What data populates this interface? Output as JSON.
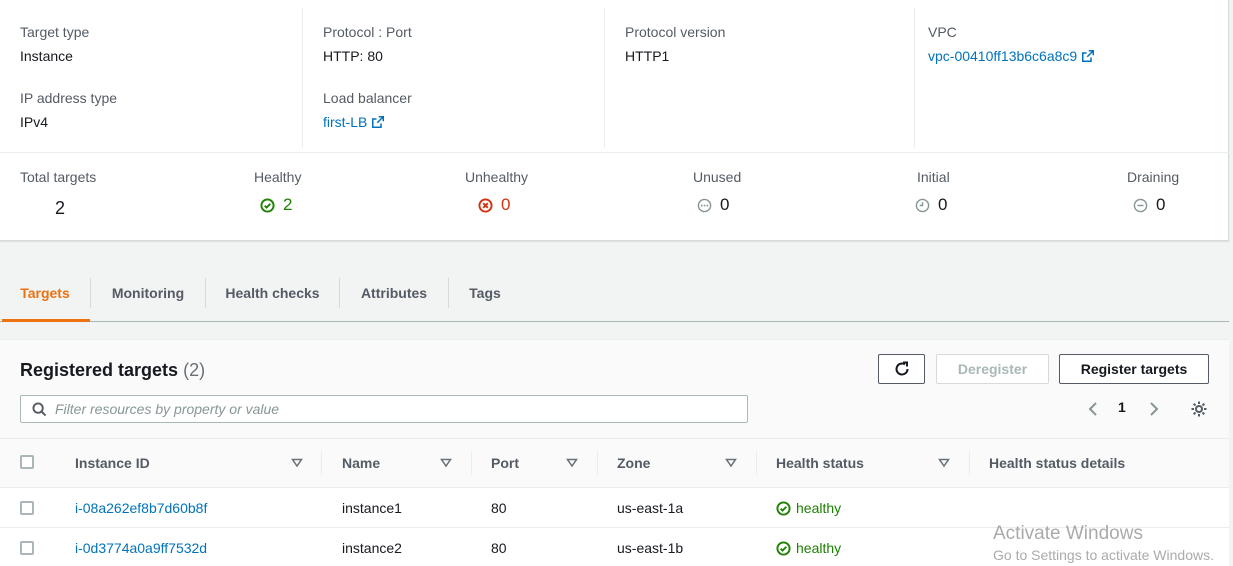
{
  "details": {
    "target_type_label": "Target type",
    "target_type_value": "Instance",
    "ip_type_label": "IP address type",
    "ip_type_value": "IPv4",
    "protocol_port_label": "Protocol : Port",
    "protocol_port_value": "HTTP: 80",
    "load_balancer_label": "Load balancer",
    "load_balancer_value": "first-LB",
    "protocol_version_label": "Protocol version",
    "protocol_version_value": "HTTP1",
    "vpc_label": "VPC",
    "vpc_value": "vpc-00410ff13b6c6a8c9"
  },
  "stats": {
    "total_label": "Total targets",
    "total_value": "2",
    "healthy_label": "Healthy",
    "healthy_value": "2",
    "unhealthy_label": "Unhealthy",
    "unhealthy_value": "0",
    "unused_label": "Unused",
    "unused_value": "0",
    "initial_label": "Initial",
    "initial_value": "0",
    "draining_label": "Draining",
    "draining_value": "0"
  },
  "tabs": [
    {
      "label": "Targets",
      "active": true
    },
    {
      "label": "Monitoring"
    },
    {
      "label": "Health checks"
    },
    {
      "label": "Attributes"
    },
    {
      "label": "Tags"
    }
  ],
  "registered": {
    "title": "Registered targets",
    "count": "(2)",
    "deregister_label": "Deregister",
    "register_label": "Register targets",
    "search_placeholder": "Filter resources by property or value",
    "page": "1"
  },
  "table": {
    "columns": [
      "Instance ID",
      "Name",
      "Port",
      "Zone",
      "Health status",
      "Health status details"
    ],
    "rows": [
      {
        "instance_id": "i-08a262ef8b7d60b8f",
        "name": "instance1",
        "port": "80",
        "zone": "us-east-1a",
        "health": "healthy",
        "details": ""
      },
      {
        "instance_id": "i-0d3774a0a9ff7532d",
        "name": "instance2",
        "port": "80",
        "zone": "us-east-1b",
        "health": "healthy",
        "details": ""
      }
    ]
  },
  "watermark": {
    "line1": "Activate Windows",
    "line2": "Go to Settings to activate Windows."
  },
  "colors": {
    "link": "#0073bb",
    "healthy": "#1d8102",
    "unhealthy": "#d13212",
    "neutral": "#687078",
    "active_tab": "#ec7211"
  }
}
